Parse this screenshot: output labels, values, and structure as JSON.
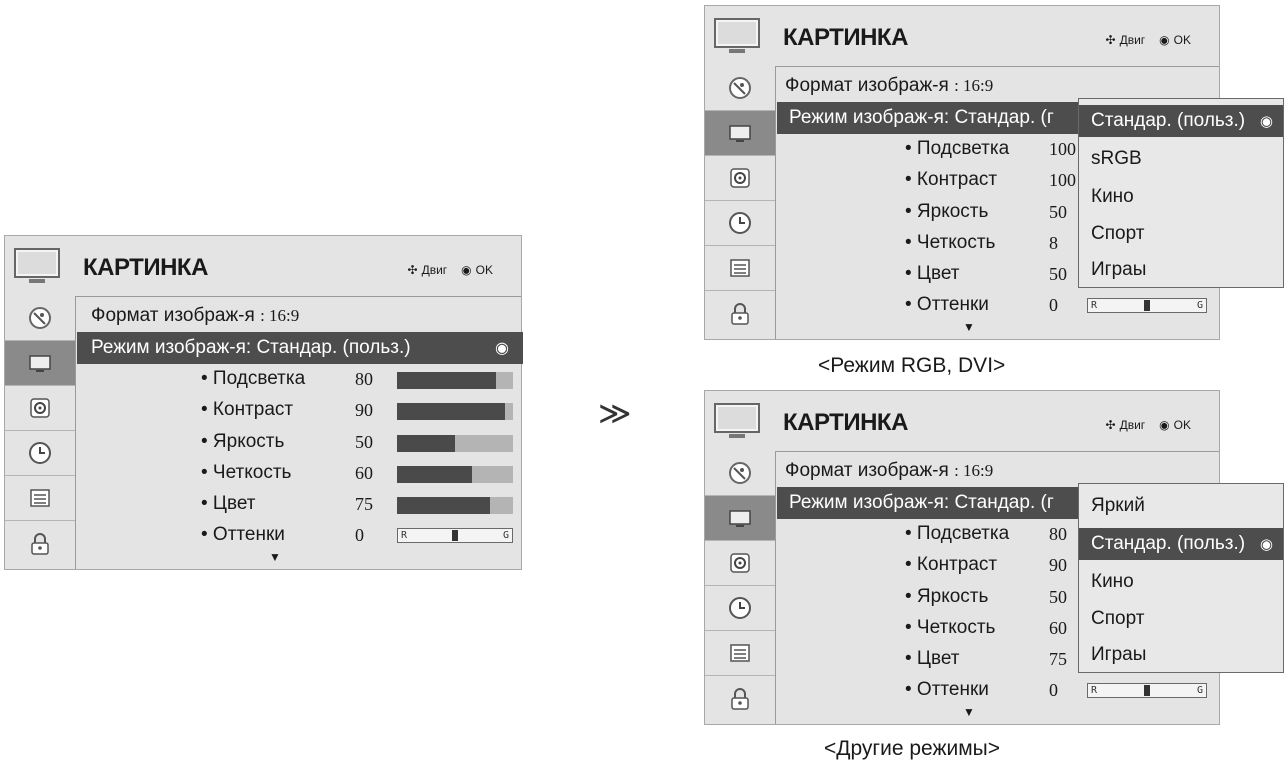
{
  "menu": {
    "title": "КАРТИНКА",
    "hint_move": "Двиг",
    "hint_ok": "OK",
    "format_label": "Формат изображ-я",
    "format_value": ": 16:9",
    "mode_label": "Режим изображ-я",
    "mode_value": ": Стандар. (польз.)",
    "mode_value_short": ": Стандар. (г",
    "sub_items": [
      "• Подсветка",
      "• Контраст",
      "• Яркость",
      "• Четкость",
      "• Цвет",
      "• Оттенки"
    ],
    "tint_left": "R",
    "tint_right": "G",
    "radio_glyph": "◉",
    "down_glyph": "▼"
  },
  "left_values": [
    "80",
    "90",
    "50",
    "60",
    "75",
    "0"
  ],
  "left_bar_levels": [
    0.85,
    0.93,
    0.5,
    0.65,
    0.8
  ],
  "rgb_values": [
    "100",
    "100",
    "50",
    "8",
    "50",
    "0"
  ],
  "other_values": [
    "80",
    "90",
    "50",
    "60",
    "75",
    "0"
  ],
  "rgb_options": [
    "Стандар. (польз.)",
    "sRGB",
    "Кино",
    "Спорт",
    "Играы"
  ],
  "other_options": [
    "Яркий",
    "Стандар. (польз.)",
    "Кино",
    "Спорт",
    "Играы"
  ],
  "caption_rgb": "<Режим RGB, DVI>",
  "caption_other": "<Другие режимы>",
  "arrow_glyph": "≫",
  "sidebar_icons": [
    "satellite-dish-icon",
    "tv-picture-icon",
    "speaker-icon",
    "clock-icon",
    "option-icon",
    "lock-icon"
  ]
}
